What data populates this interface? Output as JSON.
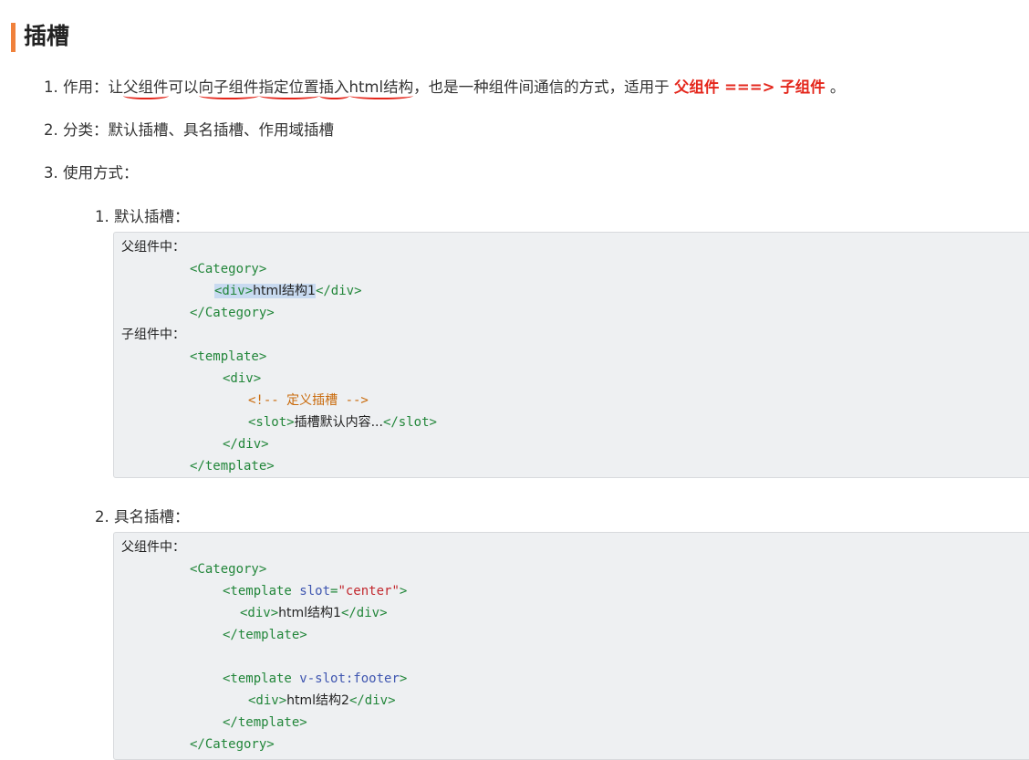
{
  "heading": "插槽",
  "items": [
    {
      "num": "1.",
      "prefix": "作用：",
      "seg1": "让",
      "u1": "父组件",
      "seg2": "可以",
      "u2": "向子组件",
      "u3": "指定位置",
      "u4": "插入",
      "u5": "html结构",
      "seg3": "，也是一种组件间通信的方式，适用于 ",
      "highlight": "父组件 ===> 子组件",
      "suffix": " 。"
    },
    {
      "num": "2.",
      "text": "分类：默认插槽、具名插槽、作用域插槽"
    },
    {
      "num": "3.",
      "text": "使用方式："
    }
  ],
  "sub_items": [
    {
      "num": "1.",
      "text": "默认插槽："
    },
    {
      "num": "2.",
      "text": "具名插槽："
    }
  ],
  "code1": {
    "l1": "父组件中：",
    "l2": "<Category>",
    "l3_open": "<div>",
    "l3_text": "html结构1",
    "l3_close": "</div>",
    "l4": "</Category>",
    "l5": "子组件中：",
    "l6": "<template>",
    "l7": "<div>",
    "l8": "<!-- 定义插槽 -->",
    "l9_open": "<slot>",
    "l9_text": "插槽默认内容...",
    "l9_close": "</slot>",
    "l10": "</div>",
    "l11": "</template>"
  },
  "code2": {
    "l1": "父组件中：",
    "l2": "<Category>",
    "l3_tag": "<template ",
    "l3_attr": "slot",
    "l3_eq": "=",
    "l3_val": "\"center\"",
    "l3_end": ">",
    "l4_open": "<div>",
    "l4_text": "html结构1",
    "l4_close": "</div>",
    "l5": "</template>",
    "l6_tag": "<template ",
    "l6_attr": "v-slot:footer",
    "l6_end": ">",
    "l7_open": "<div>",
    "l7_text": "html结构2",
    "l7_close": "</div>",
    "l8": "</template>",
    "l9": "</Category>"
  },
  "colors": {
    "accent_bar": "#f0813b",
    "highlight": "#e4261b",
    "code_bg": "#eef0f2"
  }
}
